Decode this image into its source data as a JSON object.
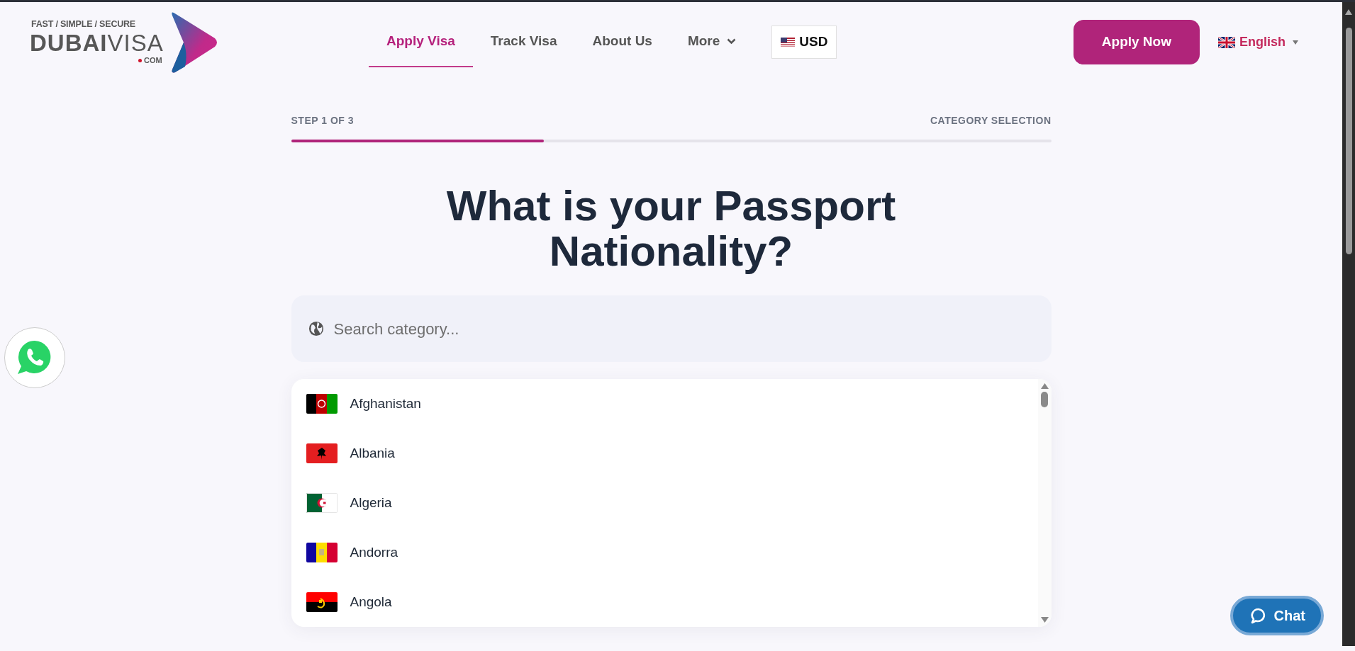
{
  "logo": {
    "tagline": "FAST / SIMPLE / SECURE",
    "name": "**DUBAI**VISA",
    "suffix": "COM"
  },
  "nav": [
    {
      "label": "Apply Visa",
      "selected": true,
      "kind": "link"
    },
    {
      "label": "Track Visa",
      "selected": false,
      "kind": "link"
    },
    {
      "label": "About Us",
      "selected": false,
      "kind": "link"
    },
    {
      "label": "More",
      "selected": false,
      "kind": "dropdown"
    }
  ],
  "currency": {
    "label": "USD"
  },
  "apply_button": {
    "label": "Apply Now"
  },
  "language": {
    "label": "English"
  },
  "progress": {
    "step": "STEP 1 OF 3",
    "section": "CATEGORY SELECTION",
    "level": 0.333
  },
  "heading": "What is your Passport Nationality?",
  "search": {
    "placeholder": "Search category..."
  },
  "countries": [
    {
      "name": "Afghanistan",
      "kind": "af"
    },
    {
      "name": "Albania",
      "kind": "al"
    },
    {
      "name": "Algeria",
      "kind": "dz"
    },
    {
      "name": "Andorra",
      "kind": "ad"
    },
    {
      "name": "Angola",
      "kind": "ao"
    }
  ],
  "chat": {
    "label": "Chat"
  }
}
